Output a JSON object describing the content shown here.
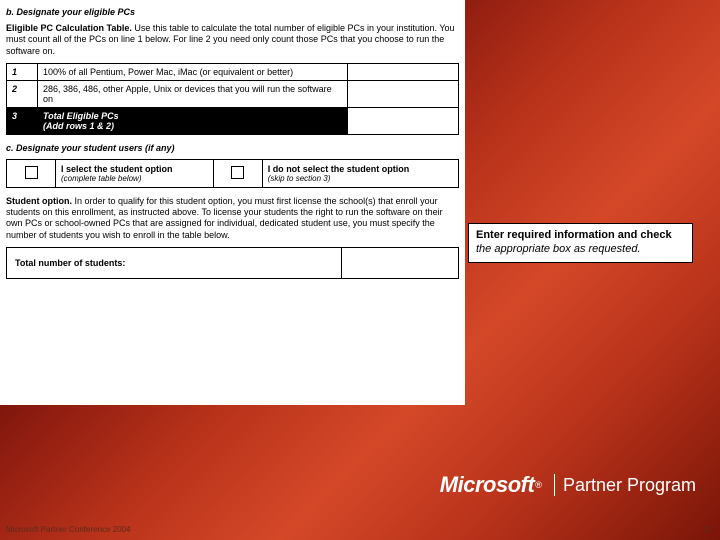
{
  "form": {
    "section_b_heading": "b.  Designate your eligible PCs",
    "calc_intro_bold": "Eligible PC Calculation Table.",
    "calc_intro_rest": "  Use this table to calculate the total number of eligible PCs in your institution. You must count all of the PCs on line 1 below.  For line 2 you need only count those PCs that you choose to run the software on.",
    "row1_num": "1",
    "row1_text": "100% of all Pentium, Power Mac, iMac (or equivalent or better)",
    "row2_num": "2",
    "row2_text": "286, 386, 486, other Apple, Unix or devices that you will run the software on",
    "row3_num": "3",
    "row3_text": "Total Eligible PCs\n(Add rows 1 & 2)",
    "section_c_heading": "c.  Designate your student users (if any)",
    "opt_yes_main": "I select the student option",
    "opt_yes_sub": "(complete table below)",
    "opt_no_main": "I do not select the student option",
    "opt_no_sub": "(skip to section 3)",
    "student_intro_bold": "Student option.",
    "student_intro_rest": "  In order to qualify for this student option, you must first license the school(s) that enroll your students on this enrollment, as instructed above. To license your students the right to run the software on their own PCs or school-owned PCs that are assigned for individual, dedicated student use, you must specify the number of students you wish to enroll in the table below.",
    "total_label": "Total number of students:"
  },
  "callout": {
    "line1": "Enter required information and check",
    "line2": "the appropriate box as requested."
  },
  "branding": {
    "ms": "Microsoft",
    "reg": "®",
    "program": "Partner Program"
  },
  "footer": {
    "text": "Microsoft Partner Conference 2004",
    "page": "13"
  }
}
